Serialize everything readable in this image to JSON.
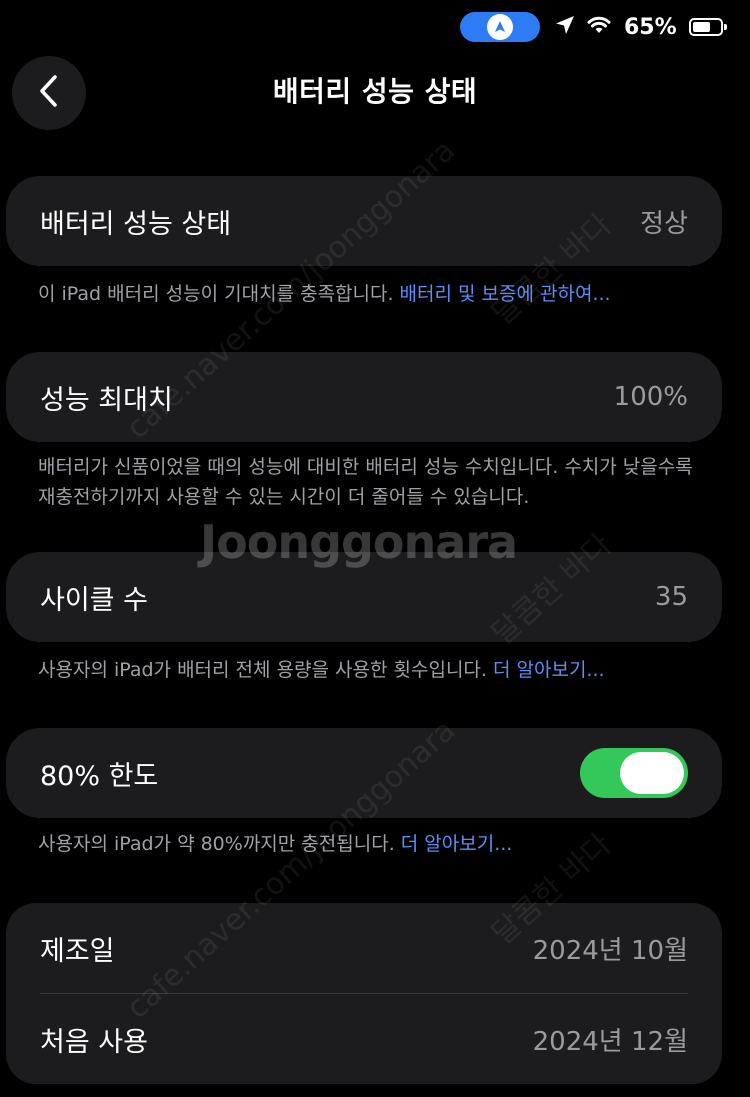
{
  "status_bar": {
    "battery_percent": "65%",
    "battery_level": 0.65
  },
  "header": {
    "title": "배터리 성능 상태"
  },
  "sections": {
    "health": {
      "label": "배터리 성능 상태",
      "value": "정상",
      "footnote": "이 iPad 배터리 성능이 기대치를 충족합니다. ",
      "footnote_link": "배터리 및 보증에 관하여..."
    },
    "max_capacity": {
      "label": "성능 최대치",
      "value": "100%",
      "footnote": "배터리가 신품이었을 때의 성능에 대비한 배터리 성능 수치입니다. 수치가 낮을수록 재충전하기까지 사용할 수 있는 시간이 더 줄어들 수 있습니다."
    },
    "cycle_count": {
      "label": "사이클 수",
      "value": "35",
      "footnote": "사용자의 iPad가 배터리 전체 용량을 사용한 횟수입니다. ",
      "footnote_link": "더 알아보기..."
    },
    "limit_80": {
      "label": "80% 한도",
      "toggle_on": true,
      "footnote": "사용자의 iPad가 약 80%까지만 충전됩니다. ",
      "footnote_link": "더 알아보기..."
    },
    "dates": {
      "manufactured_label": "제조일",
      "manufactured_value": "2024년 10월",
      "first_use_label": "처음 사용",
      "first_use_value": "2024년 12월"
    }
  },
  "watermarks": {
    "brand": "Joonggonara",
    "site": "cafe.naver.com/joonggonara",
    "seller": "달콤한 바다"
  },
  "colors": {
    "background": "#000000",
    "card": "#1c1c1e",
    "accent_link": "#5a8ff5",
    "toggle_on": "#34c759",
    "nav_pill": "#2e7bf6"
  }
}
